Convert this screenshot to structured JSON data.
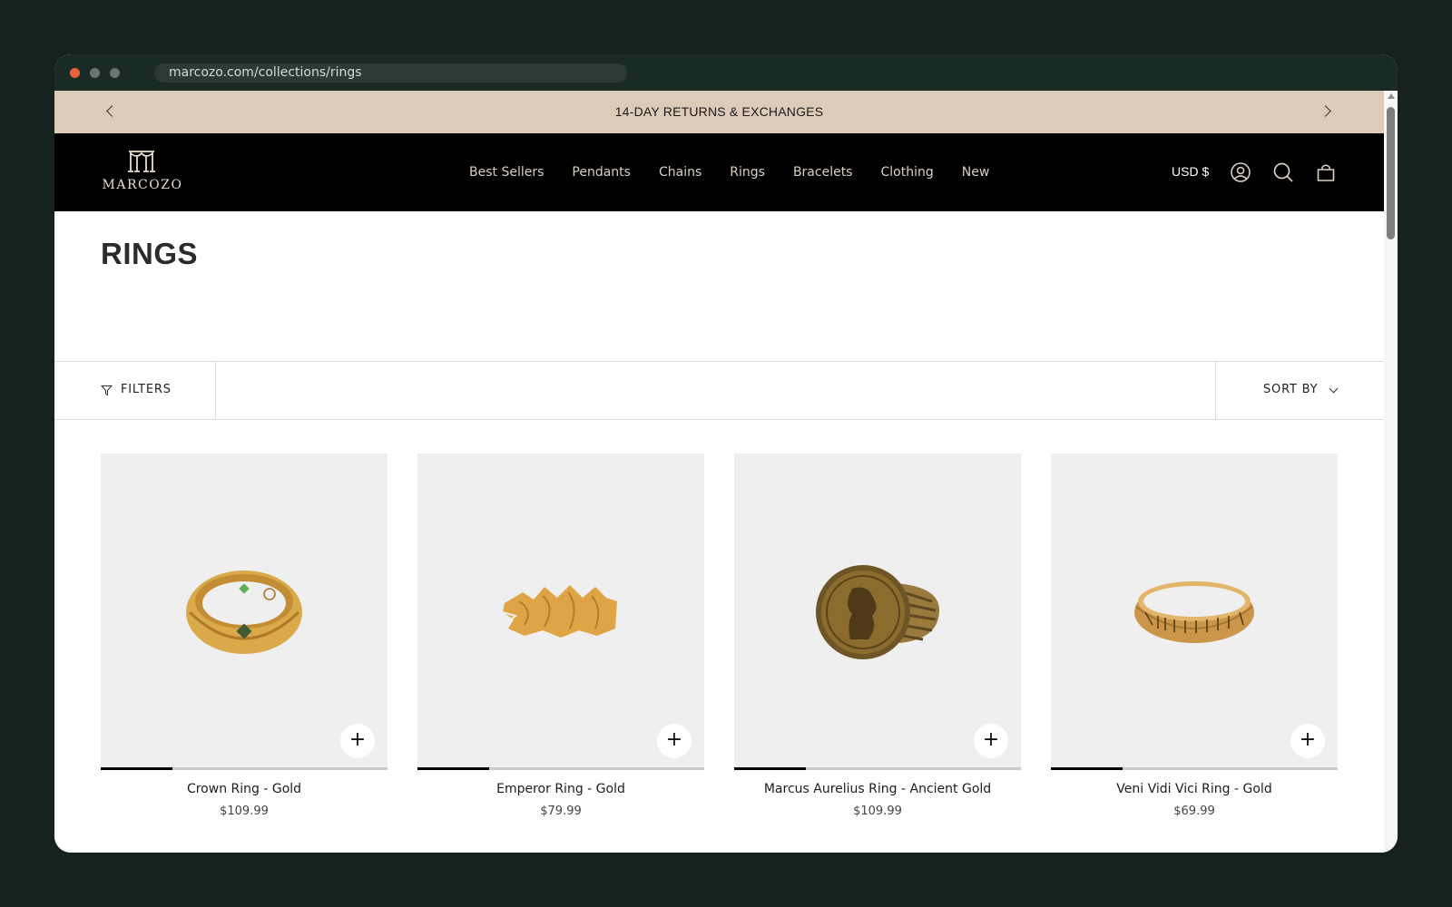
{
  "browser": {
    "url": "marcozo.com/collections/rings"
  },
  "announcement": {
    "text": "14-DAY RETURNS & EXCHANGES"
  },
  "header": {
    "logo_text": "MARCOZO",
    "nav": [
      "Best Sellers",
      "Pendants",
      "Chains",
      "Rings",
      "Bracelets",
      "Clothing",
      "New"
    ],
    "currency": "USD $",
    "icons": [
      "account-icon",
      "search-icon",
      "cart-icon"
    ]
  },
  "collection": {
    "title": "RINGS",
    "filters_label": "FILTERS",
    "sort_label": "SORT BY"
  },
  "products": [
    {
      "title": "Crown Ring - Gold",
      "price": "$109.99",
      "quick_add": "+",
      "image_progress": 0.25
    },
    {
      "title": "Emperor Ring - Gold",
      "price": "$79.99",
      "quick_add": "+",
      "image_progress": 0.25
    },
    {
      "title": "Marcus Aurelius Ring - Ancient Gold",
      "price": "$109.99",
      "quick_add": "+",
      "image_progress": 0.25
    },
    {
      "title": "Veni Vidi Vici Ring - Gold",
      "price": "$69.99",
      "quick_add": "+",
      "image_progress": 0.25
    }
  ],
  "colors": {
    "page_bg": "#15221e",
    "announcement_bg": "#ddcbb9",
    "header_bg": "#000000",
    "card_bg": "#efefef",
    "accent_dot": "#e8633a"
  }
}
